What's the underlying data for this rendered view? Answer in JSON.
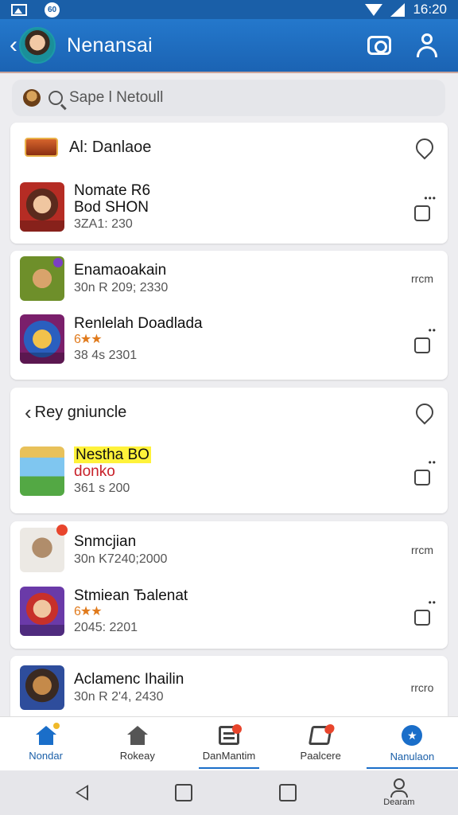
{
  "status_bar": {
    "time": "16:20",
    "circle_text": "60"
  },
  "header": {
    "title": "Nenansai"
  },
  "search": {
    "placeholder": "Sape l Netoull"
  },
  "sections": [
    {
      "title": "Al: Danlaoe",
      "items": [
        {
          "name": "Nomate R6",
          "sub": "Bod SHON",
          "date": "3ZA1: 230",
          "action": "dots",
          "dots": "•••"
        }
      ]
    },
    {
      "title": "",
      "items": [
        {
          "name": "Enamaoakain",
          "date": "30n R 209; 2330",
          "action": "text",
          "action_text": "rrcm"
        },
        {
          "name": "Renlelah Doadlada",
          "stars": "6★★",
          "date": "38 4s 2301",
          "action": "dots",
          "dots": "••"
        }
      ]
    },
    {
      "title": "Rey  gniuncle",
      "items": [
        {
          "name": "Nestha BO",
          "sub_red": "donko",
          "date": "361 s 200",
          "action": "dots",
          "dots": "••"
        }
      ]
    },
    {
      "title": "",
      "items": [
        {
          "name": "Snmcjian",
          "date": "30n K7240;2000",
          "action": "text",
          "action_text": "rrcm"
        },
        {
          "name": "Stmiean Ђаlеnat",
          "stars": "6★★",
          "date": "2045: 2201",
          "action": "dots",
          "dots": "••"
        }
      ]
    },
    {
      "title": "",
      "items": [
        {
          "name": "Aclamenc  Ihailin",
          "date": "30n R 2'4, 2430",
          "action": "text",
          "action_text": "rrcro"
        }
      ]
    }
  ],
  "bottom_nav": [
    {
      "label": "Nondar",
      "active": true
    },
    {
      "label": "Rokeay",
      "active": false
    },
    {
      "label": "DanMantim",
      "active": false
    },
    {
      "label": "Paalcere",
      "active": false
    },
    {
      "label": "Nanulaon",
      "active": true
    }
  ],
  "system_nav": {
    "profile_label": "Dearam"
  },
  "colors": {
    "brand": "#1b63b3",
    "accent_red": "#e8452c",
    "highlight": "#fff23a"
  }
}
